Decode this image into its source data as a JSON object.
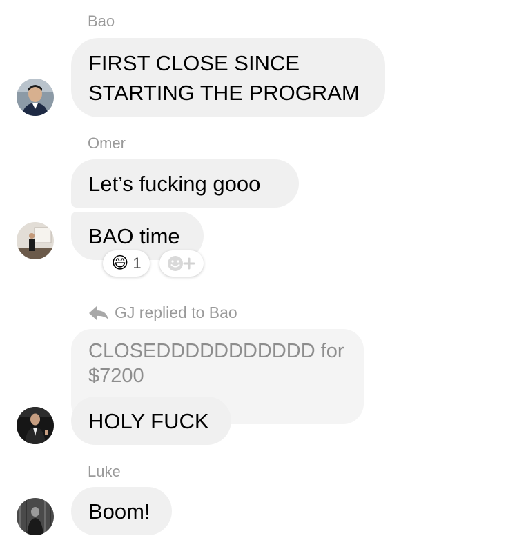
{
  "colors": {
    "bubble_bg": "#f0f0f0",
    "quoted_bubble_bg": "#f4f4f4",
    "meta_text": "#9a9a9a",
    "quoted_text": "#8d8d8d"
  },
  "conversation": {
    "group1": {
      "sender": "Bao",
      "message": "FIRST CLOSE SINCE STARTING THE PROGRAM"
    },
    "group2": {
      "sender": "Omer",
      "message1": "Let’s fucking gooo",
      "message2": "BAO time",
      "reaction": {
        "emoji": "😄",
        "count": "1",
        "add_reaction_icon": "add-reaction-icon"
      }
    },
    "group3": {
      "reply_text": "GJ replied to Bao",
      "reply_icon": "reply-arrow-icon",
      "quoted_message": "CLOSEDDDDDDDDDDD for $7200",
      "message": "HOLY FUCK"
    },
    "group4": {
      "sender": "Luke",
      "message": "Boom!"
    }
  }
}
